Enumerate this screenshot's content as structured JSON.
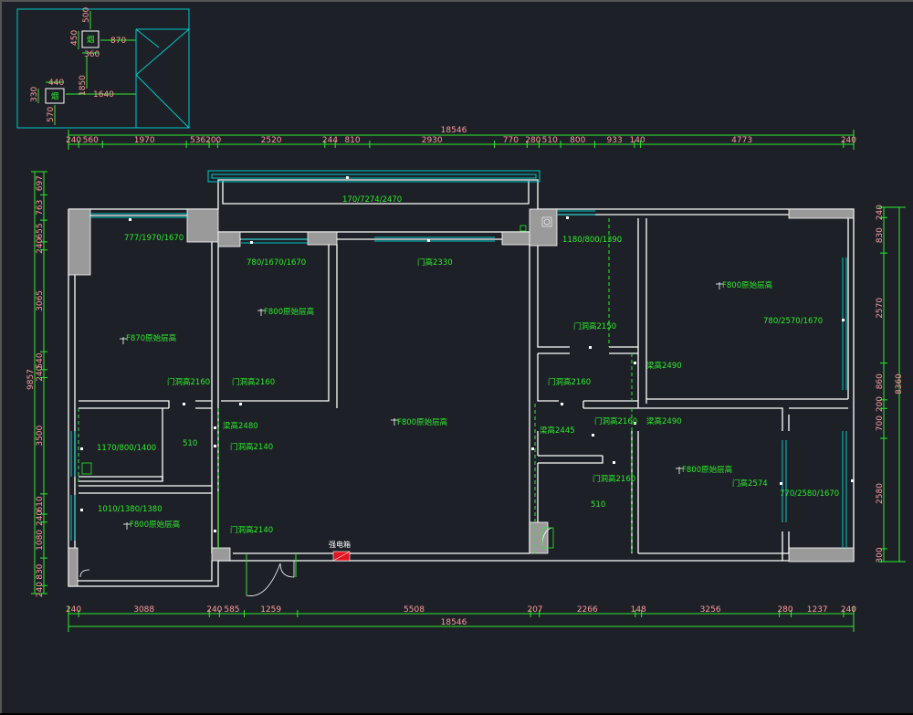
{
  "colors": {
    "background": "#1d2127",
    "wall": "#ffffff",
    "dimension_line": "#2dea2d",
    "dimension_text": "#ff9a9a",
    "window": "#00c8c8",
    "column": "#9a9a9a",
    "electric_box": "#e0141e"
  },
  "inset": {
    "dims": [
      "500",
      "450",
      "870",
      "360",
      "440",
      "1850",
      "330",
      "1640",
      "570"
    ],
    "labels": [
      "烟",
      "烟"
    ]
  },
  "top_dims": {
    "total": "18546",
    "segments": [
      "240",
      "560",
      "1970",
      "536",
      "200",
      "2520",
      "244",
      "810",
      "2930",
      "770",
      "280",
      "510",
      "800",
      "933",
      "140",
      "4773",
      "240"
    ]
  },
  "bottom_dims": {
    "total": "18546",
    "segments": [
      "240",
      "3088",
      "240",
      "585",
      "1259",
      "5508",
      "207",
      "2266",
      "148",
      "3256",
      "280",
      "1237",
      "240"
    ]
  },
  "left_dims": {
    "total": "9857",
    "segments": [
      "697",
      "763",
      "655",
      "240",
      "3065",
      "540",
      "240",
      "3500",
      "610",
      "240",
      "1080",
      "830",
      "240"
    ]
  },
  "right_dims": {
    "total": "8360",
    "segments": [
      "240",
      "830",
      "2570",
      "860",
      "200",
      "700",
      "2580",
      "300"
    ]
  },
  "labels": {
    "win_top": "170/7274/2470",
    "win_br1": "777/1970/1670",
    "win_br2": "780/1670/1670",
    "door_main": "门高2330",
    "win_kitchen": "1180/800/1390",
    "ceil_br1": "F870原始层高",
    "ceil_br2": "F800原始层高",
    "ceil_living": "F800原始层高",
    "ceil_rb": "F800原始层高",
    "ceil_rb2": "F800原始层高",
    "ceil_left_lower": "F800原始层高",
    "win_rb": "780/2570/1670",
    "door_k": "门洞高2150",
    "beam_1": "梁高2490",
    "door_1": "门洞高2160",
    "door_2": "门洞高2160",
    "door_3": "门洞高2160",
    "beam_2": "梁高2480",
    "door_4": "门洞高2140",
    "win_left_mid": "1170/800/1400",
    "box_label_1": "510",
    "door_5": "门洞高2160",
    "beam_3": "梁高2490",
    "beam_4": "梁高2445",
    "door_6": "门洞高2160",
    "win_left_low": "1010/1380/1380",
    "door_7": "门洞高2140",
    "door_8": "门高2574",
    "win_rb2": "770/2580/1670",
    "box_label_2": "510",
    "elec_box": "强电箱"
  }
}
